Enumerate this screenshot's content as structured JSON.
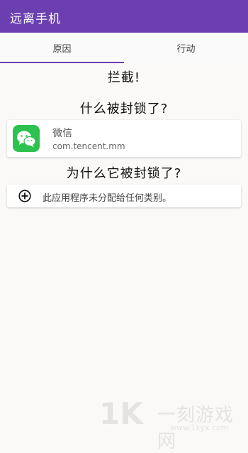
{
  "appbar": {
    "title": "远离手机",
    "color": "#6b3fb0"
  },
  "tabs": [
    {
      "label": "原因",
      "selected": true
    },
    {
      "label": "行动",
      "selected": false
    }
  ],
  "content": {
    "blocked_title": "拦截!",
    "what_blocked_title": "什么被封锁了?",
    "app": {
      "name": "微信",
      "package": "com.tencent.mm",
      "icon": "wechat-icon"
    },
    "why_blocked_title": "为什么它被封锁了?",
    "reason": {
      "icon": "add-circle-icon",
      "text": "此应用程序未分配给任何类别。"
    }
  },
  "watermark": {
    "logo": "1K",
    "brand": "一刻游戏网",
    "url": "www.1kyx.com"
  }
}
